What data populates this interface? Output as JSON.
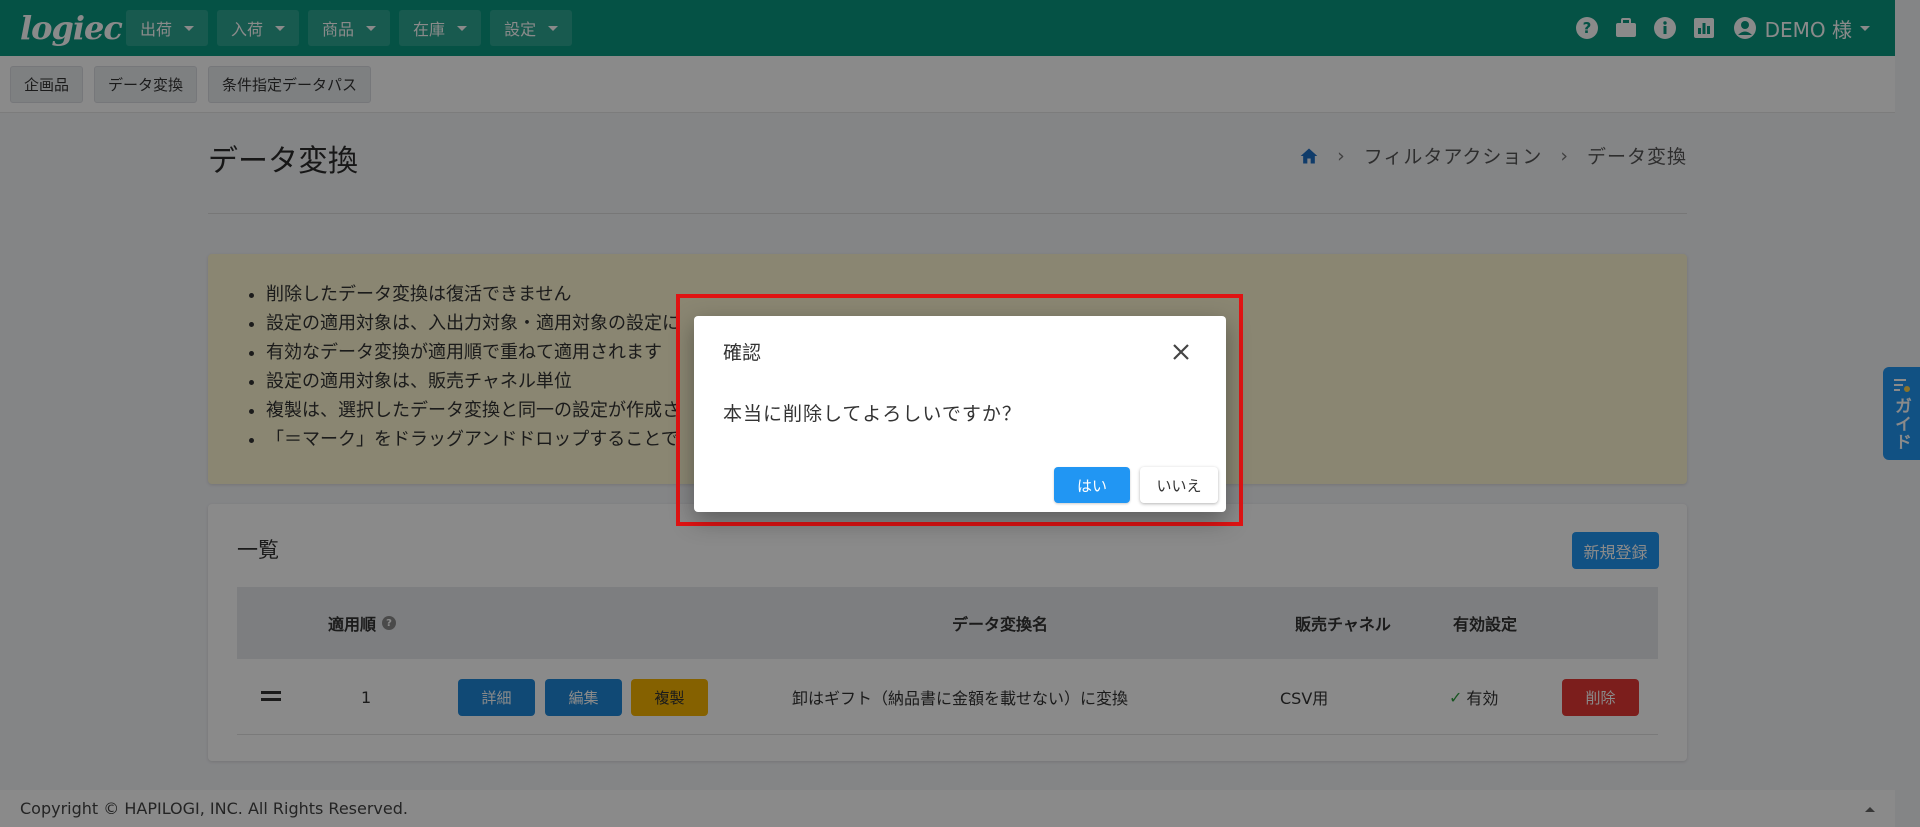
{
  "header": {
    "logo": "logiec",
    "menu": [
      {
        "label": "出荷"
      },
      {
        "label": "入荷"
      },
      {
        "label": "商品"
      },
      {
        "label": "在庫"
      },
      {
        "label": "設定"
      }
    ],
    "user": "DEMO 様"
  },
  "subnav": [
    "企画品",
    "データ変換",
    "条件指定データパス"
  ],
  "page": {
    "title": "データ変換",
    "breadcrumb": [
      "フィルタアクション",
      "データ変換"
    ]
  },
  "notice": [
    "削除したデータ変換は復活できません",
    "設定の適用対象は、入出力対象・適用対象の設定に",
    "有効なデータ変換が適用順で重ねて適用されます",
    "設定の適用対象は、販売チャネル単位",
    "複製は、選択したデータ変換と同一の設定が作成さ",
    "「＝マーク」をドラッグアンドドロップすることで"
  ],
  "list": {
    "title": "一覧",
    "new_label": "新規登録",
    "columns": {
      "order": "適用順",
      "name": "データ変換名",
      "channel": "販売チャネル",
      "status": "有効設定"
    },
    "rows": [
      {
        "order": "1",
        "detail_label": "詳細",
        "edit_label": "編集",
        "copy_label": "複製",
        "name": "卸はギフト（納品書に金額を載せない）に変換",
        "channel": "CSV用",
        "status": "有効",
        "delete_label": "削除"
      }
    ]
  },
  "footer": {
    "copyright": "Copyright © HAPILOGI, INC. All Rights Reserved."
  },
  "guide": {
    "label": "ガイド"
  },
  "dialog": {
    "title": "確認",
    "message": "本当に削除してよろしいですか？",
    "yes_label": "はい",
    "no_label": "いいえ"
  },
  "colors": {
    "header": "#0b9880",
    "primary": "#2196f3",
    "warning": "#f5b400",
    "danger": "#e53935",
    "highlight": "#e01313"
  }
}
